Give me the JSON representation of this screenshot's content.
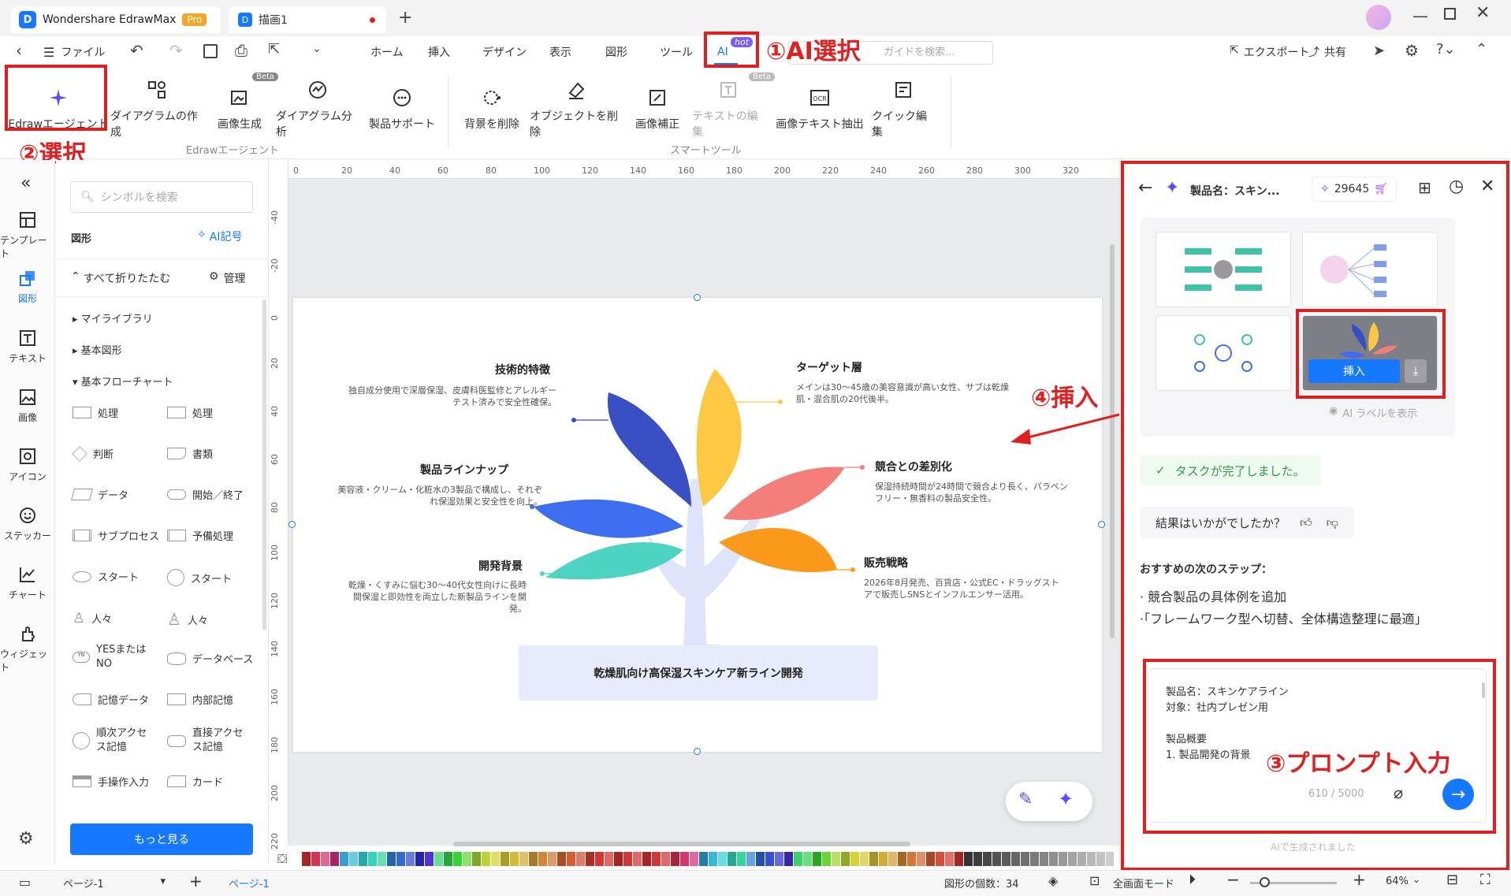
{
  "titlebar": {
    "app_name": "Wondershare EdrawMax",
    "badge": "Pro",
    "doc_tab": "描画1"
  },
  "menubar": {
    "file": "ファイル",
    "items": [
      "ホーム",
      "挿入",
      "デザイン",
      "表示",
      "図形",
      "ツール"
    ],
    "ai_tab": "AI",
    "ai_badge": "hot",
    "search_placeholder": "ガイドを検索...",
    "export": "エクスポート",
    "share": "共有"
  },
  "ribbon": {
    "agent": "Edrawエージェント",
    "items": [
      "ダイアグラムの作成",
      "画像生成",
      "ダイアグラム分析",
      "製品サポート"
    ],
    "beta": "Beta",
    "smart": [
      "背景を削除",
      "オブジェクトを削除",
      "画像補正",
      "テキストの編集",
      "画像テキスト抽出",
      "クイック編集"
    ],
    "group1": "Edrawエージェント",
    "group2": "スマートツール"
  },
  "annotations": {
    "a1": "①AI選択",
    "a2": "②選択",
    "a3": "③プロンプト入力",
    "a4": "④挿入"
  },
  "sidebar": {
    "items": [
      "テンプレート",
      "図形",
      "テキスト",
      "画像",
      "アイコン",
      "ステッカー",
      "チャート",
      "ウィジェット"
    ]
  },
  "library": {
    "search_placeholder": "シンボルを検索",
    "shapes": "図形",
    "ai_symbol": "AI記号",
    "collapse_all": "すべて折りたたむ",
    "manage": "管理",
    "my_library": "マイライブラリ",
    "basic_shapes": "基本図形",
    "basic_flow": "基本フローチャート",
    "shapes_list": [
      "処理",
      "処理",
      "判断",
      "書類",
      "データ",
      "開始／終了",
      "サブプロセス",
      "予備処理",
      "スタート",
      "スタート",
      "人々",
      "人々",
      "YESまたはNO",
      "データベース",
      "記憶データ",
      "内部記憶",
      "順次アクセス記憶",
      "直接アクセス記憶",
      "手操作入力",
      "カード"
    ],
    "more": "もっと見る"
  },
  "ruler": {
    "top": [
      "0",
      "20",
      "40",
      "60",
      "80",
      "100",
      "120",
      "140",
      "160",
      "180",
      "200",
      "220",
      "240",
      "260",
      "280",
      "300",
      "320"
    ],
    "left": [
      "-40",
      "-20",
      "0",
      "20",
      "40",
      "60",
      "80",
      "100",
      "120",
      "140",
      "160",
      "180",
      "200",
      "220"
    ]
  },
  "diagram": {
    "center": "乾燥肌向け高保湿スキンケア新ライン開発",
    "nodes": [
      {
        "title": "技術的特徴",
        "desc": "独自成分使用で深層保湿、皮膚科医監修とアレルギーテスト済みで安全性確保。"
      },
      {
        "title": "ターゲット層",
        "desc": "メインは30〜45歳の美容意識が高い女性、サブは乾燥肌・混合肌の20代後半。"
      },
      {
        "title": "製品ラインナップ",
        "desc": "美容液・クリーム・化粧水の3製品で構成し、それぞれ保湿効果と安全性を向上。"
      },
      {
        "title": "競合との差別化",
        "desc": "保湿持続時間が24時間で競合より長く、パラベンフリー・無香料の製品安全性。"
      },
      {
        "title": "開発背景",
        "desc": "乾燥・くすみに悩む30〜40代女性向けに長時間保湿と即効性を両立した新製品ラインを開発。"
      },
      {
        "title": "販売戦略",
        "desc": "2026年8月発売、百貨店・公式EC・ドラッグストアで販売しSNSとインフルエンサー活用。"
      }
    ]
  },
  "ai_panel": {
    "title": "製品名：スキン...",
    "credits": "29645",
    "insert": "挿入",
    "show_labels": "AI ラベルを表示",
    "task_done": "タスクが完了しました。",
    "feedback": "結果はいかがでしたか？",
    "next_steps": "おすすめの次のステップ：",
    "steps": [
      "· 競合製品の具体例を追加",
      "·「フレームワーク型へ切替、全体構造整理に最適」"
    ],
    "prompt_lines": [
      "製品名：スキンケアライン",
      "対象：社内プレゼン用",
      "",
      "製品概要",
      "1. 製品開発の背景"
    ],
    "counter": "610 / 5000",
    "footer": "AIで生成されました"
  },
  "statusbar": {
    "page_select": "ページ-1",
    "page_tab": "ページ-1",
    "shape_count": "図形の個数：34",
    "fullscreen": "全画面モード",
    "zoom": "64%"
  },
  "colors": {
    "accent": "#1677ff",
    "red": "#e02020",
    "leaf_blue_dark": "#3b4fc4",
    "leaf_yellow": "#fcc844",
    "leaf_red": "#f47f7a",
    "leaf_blue": "#3e6ef0",
    "leaf_teal": "#4cd3c2",
    "leaf_orange": "#fb9a1a"
  }
}
